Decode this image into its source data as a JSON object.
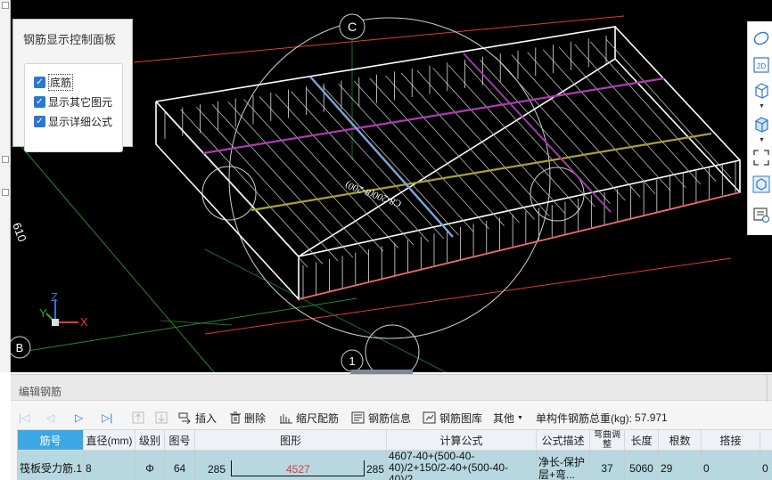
{
  "viewport": {
    "axis_labels": {
      "c": "C",
      "b": "B",
      "one": "1",
      "left_edge": "610"
    },
    "rebar_text": "C8-200(8-200)",
    "gizmo": {
      "x": "X",
      "y": "Y",
      "z": "Z"
    },
    "colors": {
      "background": "#000000",
      "slab": "#ffffff",
      "axis_line": "#e53935",
      "grid_line": "#1f8a2e"
    }
  },
  "control_panel": {
    "title": "钢筋显示控制面板",
    "options": [
      {
        "label": "底筋",
        "checked": true
      },
      {
        "label": "显示其它图元",
        "checked": true
      },
      {
        "label": "显示详细公式",
        "checked": true
      }
    ]
  },
  "right_toolbar": {
    "items": [
      "orbit-icon",
      "2d-view-icon",
      "3d-box-icon",
      "shaded-box-icon",
      "fit-view-icon",
      "cube-view-icon",
      "rebar-view-icon"
    ],
    "label_2d": "2D"
  },
  "edit_panel": {
    "title": "编辑钢筋",
    "toolbar": {
      "insert": "插入",
      "delete": "删除",
      "scale_rebar": "缩尺配筋",
      "rebar_info": "钢筋信息",
      "rebar_library": "钢筋图库",
      "other": "其他",
      "total_weight_label": "单构件钢筋总重(kg):",
      "total_weight_value": "57.971"
    },
    "table": {
      "columns": [
        "筋号",
        "直径(mm)",
        "级别",
        "图号",
        "图形",
        "计算公式",
        "公式描述",
        "弯曲调整",
        "长度",
        "根数",
        "搭接",
        ""
      ],
      "rows": [
        {
          "name": "筏板受力筋.1",
          "diameter": "8",
          "grade": "Φ",
          "fig_no": "64",
          "shape_left": "285",
          "shape_mid": "4527",
          "shape_right": "285",
          "formula": "4607-40+(500-40-40)/2+150/2-40+(500-40-40)/2...",
          "description": "净长-保护层+弯...",
          "bend_adjust": "37",
          "length": "5060",
          "count": "29",
          "lap": "0",
          "extra": "0"
        }
      ]
    }
  }
}
